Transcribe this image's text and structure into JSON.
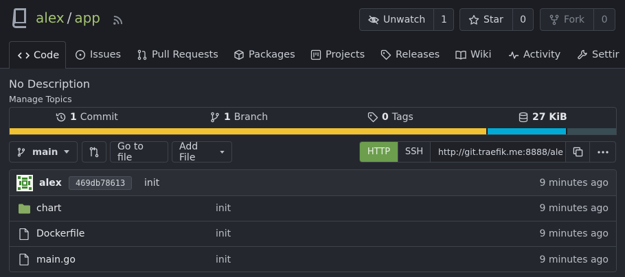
{
  "repo": {
    "owner": "alex",
    "separator": "/",
    "name": "app"
  },
  "actions": {
    "watch": {
      "label": "Unwatch",
      "count": "1"
    },
    "star": {
      "label": "Star",
      "count": "0"
    },
    "fork": {
      "label": "Fork",
      "count": "0"
    }
  },
  "tabs": [
    {
      "label": "Code",
      "icon": "code-icon"
    },
    {
      "label": "Issues",
      "icon": "issue-icon"
    },
    {
      "label": "Pull Requests",
      "icon": "pull-request-icon"
    },
    {
      "label": "Packages",
      "icon": "package-icon"
    },
    {
      "label": "Projects",
      "icon": "project-icon"
    },
    {
      "label": "Releases",
      "icon": "tag-icon"
    },
    {
      "label": "Wiki",
      "icon": "book-icon"
    },
    {
      "label": "Activity",
      "icon": "pulse-icon"
    },
    {
      "label": "Settir",
      "icon": "tools-icon"
    }
  ],
  "description": "No Description",
  "manage_topics": "Manage Topics",
  "stats": {
    "commits": {
      "count": "1",
      "label": "Commit"
    },
    "branches": {
      "count": "1",
      "label": "Branch"
    },
    "tags": {
      "count": "0",
      "label": "Tags"
    },
    "size": {
      "count": "27 KiB",
      "label": ""
    }
  },
  "language_bar": [
    {
      "color": "#f1c232",
      "fraction": 0.786
    },
    {
      "color": "#00acd7",
      "fraction": 0.131
    },
    {
      "color": "#384d54",
      "fraction": 0.083
    }
  ],
  "toolbar": {
    "branch": "main",
    "goto_file": "Go to file",
    "add_file": "Add File",
    "http": "HTTP",
    "ssh": "SSH",
    "clone_url": "http://git.traefik.me:8888/ale"
  },
  "latest_commit": {
    "author": "alex",
    "sha": "469db78613",
    "message": "init",
    "time": "9 minutes ago"
  },
  "files": [
    {
      "name": "chart",
      "type": "folder",
      "message": "init",
      "time": "9 minutes ago"
    },
    {
      "name": "Dockerfile",
      "type": "file",
      "message": "init",
      "time": "9 minutes ago"
    },
    {
      "name": "main.go",
      "type": "file",
      "message": "init",
      "time": "9 minutes ago"
    }
  ],
  "colors": {
    "accent": "#a5c371",
    "http_active": "#6c9e4e",
    "folder": "#87ab63"
  }
}
